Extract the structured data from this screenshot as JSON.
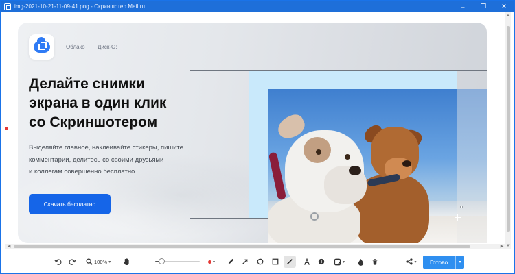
{
  "window": {
    "title": "img-2021-10-21-11-09-41.png - Скриншотер Mail.ru",
    "controls": [
      "–",
      "❐",
      "✕"
    ]
  },
  "hero": {
    "nav_links": [
      "Облако",
      "Диск-О:"
    ],
    "headline_lines": [
      "Делайте снимки",
      "экрана в один клик",
      "со Скриншотером"
    ],
    "subtext_lines": [
      "Выделяйте главное, наклеивайте стикеры, пишите",
      "комментарии, делитесь со своими друзьями",
      "и коллегам совершенно бесплатно"
    ],
    "cta_label": "Скачать бесплатно"
  },
  "toolbar": {
    "zoom_value": "100%",
    "zoom_caret": "▾",
    "brush_size": 0.15,
    "color_caret": "▾",
    "sticker_caret": "▾",
    "share_caret": "▾",
    "done_label": "Готово",
    "done_caret": "▾",
    "active_tool": "pen",
    "colors": {
      "accent": "#1e6fd9",
      "selected_color": "#e53935",
      "done_button": "#2f8ff0",
      "cta": "#1565e8"
    }
  },
  "icons": {
    "titlebar": "screenshot-app-icon",
    "undo": "undo-icon",
    "redo": "redo-icon",
    "zoom": "magnifier-icon",
    "hand": "hand-icon",
    "pen": "pen-icon",
    "arrow": "arrow-icon",
    "ellipse": "circle-icon",
    "rectangle": "square-icon",
    "line": "line-icon",
    "text": "text-icon",
    "numbered": "number-marker-icon",
    "sticker": "sticker-icon",
    "blur": "blur-drop-icon",
    "delete": "trash-icon",
    "share": "share-icon"
  }
}
